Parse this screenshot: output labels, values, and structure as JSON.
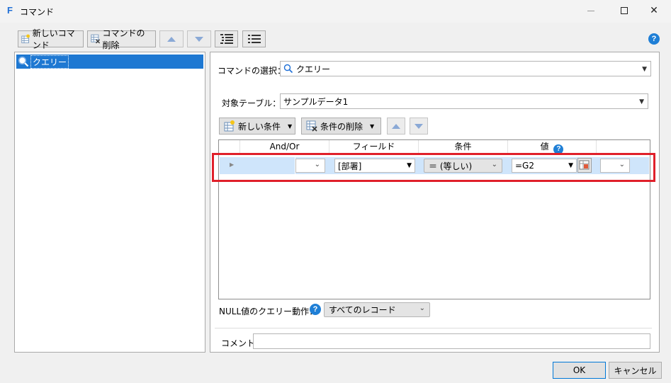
{
  "window": {
    "title": "コマンド",
    "app_icon": "F"
  },
  "toolbar": {
    "new_command": "新しいコマンド",
    "delete_command": "コマンドの削除"
  },
  "tree": {
    "items": [
      {
        "label": "クエリー",
        "selected": true
      }
    ]
  },
  "form": {
    "command_select_label": "コマンドの選択：",
    "command_select_value": "クエリー",
    "target_table_label": "対象テーブル：",
    "target_table_value": "サンプルデータ1"
  },
  "conditions_toolbar": {
    "new_condition": "新しい条件",
    "delete_condition": "条件の削除"
  },
  "grid": {
    "columns": [
      "And/Or",
      "フィールド",
      "条件",
      "値"
    ],
    "rows": [
      {
        "andor": "",
        "field": "[部署]",
        "condition": "＝ (等しい)",
        "value": "=G2",
        "extra": ""
      }
    ],
    "highlight_color": "#e0202a"
  },
  "null_behavior": {
    "label": "NULL値のクエリー動作：",
    "value": "すべてのレコード"
  },
  "comment": {
    "label": "コメント",
    "value": ""
  },
  "buttons": {
    "ok": "OK",
    "cancel": "キャンセル"
  },
  "colors": {
    "accent": "#1e78d2",
    "row_selected": "#cfe5fb",
    "highlight": "#e0202a"
  }
}
